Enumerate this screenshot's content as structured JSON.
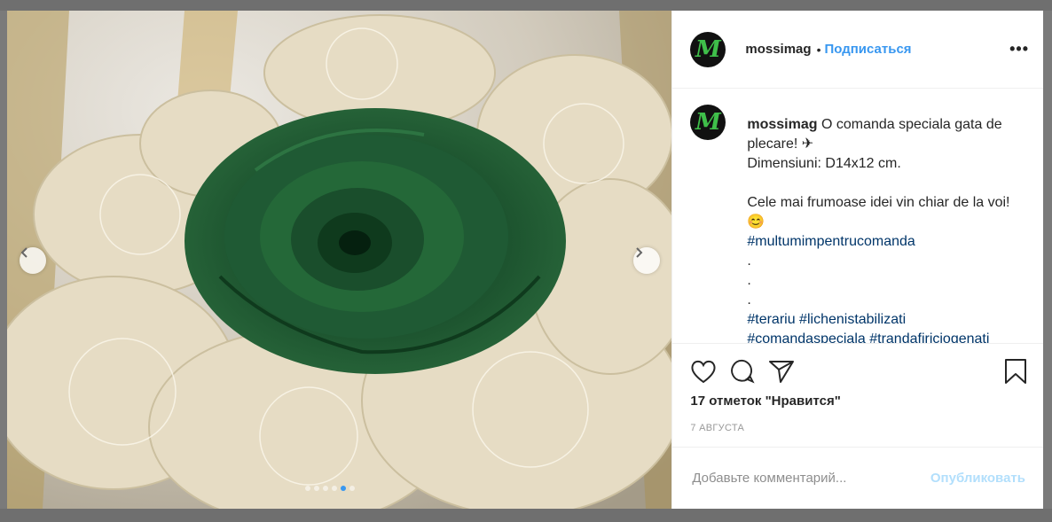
{
  "post": {
    "username": "mossimag",
    "separator": "•",
    "follow_label": "Подписаться",
    "more_label": "•••",
    "avatar_letter": "M",
    "caption": {
      "username": "mossimag",
      "line1": " O comanda speciala gata de plecare! ✈",
      "line2": "Dimensiuni: D14x12 cm.",
      "line3": "Cele mai frumoase idei vin chiar de la voi! 😊",
      "tag1": "#multumimpentrucomanda",
      "dot": ".",
      "tags2": "#terariu #lichenistabilizati",
      "tags3": "#comandaspeciala #trandafiriciogenati"
    },
    "likes_text": "17 отметок \"Нравится\"",
    "date_text": "7 августа",
    "comment_placeholder": "Добавьте комментарий...",
    "publish_label": "Опубликовать"
  },
  "carousel": {
    "count": 6,
    "active_index": 4
  },
  "colors": {
    "accent": "#3897f0",
    "rose": "#1f5a34",
    "moss": "#e8e0cc"
  }
}
